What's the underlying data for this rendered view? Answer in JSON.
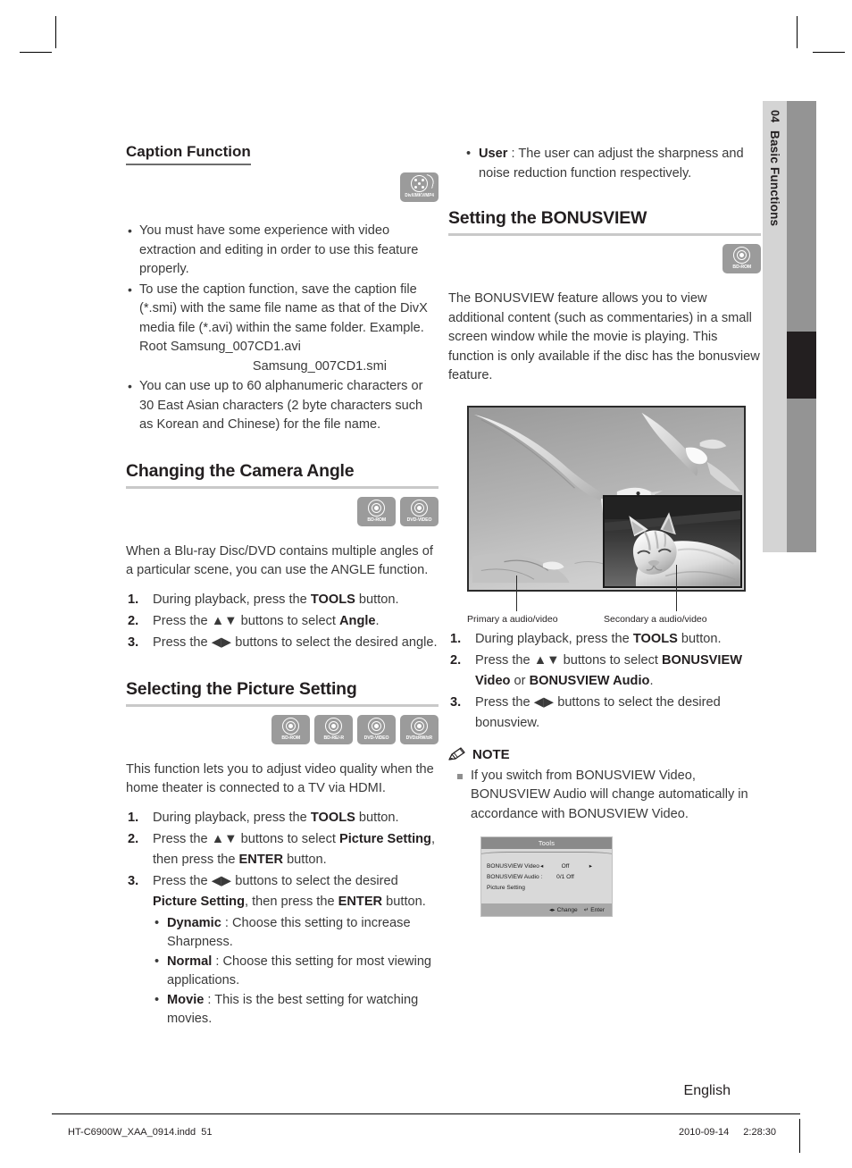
{
  "sidebar_tab": {
    "chapter_number": "04",
    "chapter_title": "Basic Functions"
  },
  "left_column": {
    "caption_function": {
      "title": "Caption Function",
      "badge": {
        "icon": "divx-disc-icon",
        "label": "DivX/MKV/MP4"
      },
      "bullets": [
        "You must have some experience with video extraction and editing in order to use this feature properly.",
        "To use the caption function, save the caption file (*.smi) with the same file name as that of the DivX media file (*.avi) within the same folder. Example. Root Samsung_007CD1.avi",
        "You can use up to 60 alphanumeric characters or 30 East Asian characters (2 byte characters such as Korean and Chinese) for the file name."
      ],
      "example_second_line": "Samsung_007CD1.smi"
    },
    "camera_angle": {
      "title": "Changing the Camera Angle",
      "badges": [
        {
          "icon": "disc-icon",
          "label": "BD-ROM"
        },
        {
          "icon": "disc-icon",
          "label": "DVD-VIDEO"
        }
      ],
      "intro": "When a Blu-ray Disc/DVD contains multiple angles of a particular scene, you can use the ANGLE function.",
      "steps": [
        {
          "num": "1.",
          "text_parts": [
            "During playback, press the ",
            "TOOLS",
            " button."
          ]
        },
        {
          "num": "2.",
          "text_parts": [
            "Press the ▲▼ buttons to select ",
            "Angle",
            "."
          ]
        },
        {
          "num": "3.",
          "text_parts": [
            "Press the ◀▶ buttons to select the desired angle.",
            "",
            ""
          ]
        }
      ]
    },
    "picture_setting": {
      "title": "Selecting the Picture Setting",
      "badges": [
        {
          "icon": "disc-icon",
          "label": "BD-ROM"
        },
        {
          "icon": "disc-icon",
          "label": "BD-RE/-R"
        },
        {
          "icon": "disc-icon",
          "label": "DVD-VIDEO"
        },
        {
          "icon": "disc-icon",
          "label": "DVD±RW/±R"
        }
      ],
      "intro": "This function lets you to adjust video quality when the home theater is connected to a TV via HDMI.",
      "step1": {
        "num": "1.",
        "a": "During playback, press the ",
        "b": "TOOLS",
        "c": " button."
      },
      "step2": {
        "num": "2.",
        "a": "Press the ▲▼ buttons to select ",
        "b": "Picture Setting",
        "c": ", then press the ",
        "d": "ENTER",
        "e": " button."
      },
      "step3": {
        "num": "3.",
        "a": "Press the ◀▶ buttons to select the desired ",
        "b": "Picture Setting",
        "c": ", then press the ",
        "d": "ENTER",
        "e": " button."
      },
      "options": [
        {
          "name": "Dynamic",
          "desc": " : Choose this setting to increase Sharpness."
        },
        {
          "name": "Normal",
          "desc": " : Choose this setting for most viewing applications."
        },
        {
          "name": "Movie",
          "desc": " : This is the best setting for watching movies."
        }
      ]
    }
  },
  "right_column": {
    "user_option": {
      "name": "User",
      "desc": " : The user can adjust the sharpness and noise reduction function respectively."
    },
    "bonusview": {
      "title": "Setting the BONUSVIEW",
      "badge": {
        "icon": "disc-icon",
        "label": "BD-ROM"
      },
      "intro": "The BONUSVIEW feature allows you to view additional content (such as commentaries) in a small screen window while the movie is playing. This function is only available if the disc has the bonusview feature.",
      "figure": {
        "primary_label": "Primary a audio/video",
        "secondary_label": "Secondary a audio/video",
        "primary_alt": "seagulls-flying-photo",
        "secondary_alt": "sleeping-cat-photo"
      },
      "step1": {
        "num": "1.",
        "a": "During playback, press the ",
        "b": "TOOLS",
        "c": " button."
      },
      "step2": {
        "num": "2.",
        "a": "Press the ▲▼ buttons to select ",
        "b": "BONUSVIEW Video",
        "c": " or ",
        "d": "BONUSVIEW Audio",
        "e": "."
      },
      "step3": {
        "num": "3.",
        "a": "Press the ◀▶ buttons to select the desired bonusview."
      },
      "note": {
        "heading": "NOTE",
        "items": [
          "If you switch from BONUSVIEW Video, BONUSVIEW Audio will change automatically in accordance with BONUSVIEW Video."
        ]
      },
      "osd": {
        "title": "Tools",
        "rows": [
          {
            "label": "BONUSVIEW Video",
            "left_arrow": "◂",
            "value": "Off",
            "right_arrow": "▸"
          },
          {
            "label": "BONUSVIEW Audio :",
            "left_arrow": "",
            "value": "0/1 Off",
            "right_arrow": ""
          },
          {
            "label": "Picture Setting",
            "left_arrow": "",
            "value": "",
            "right_arrow": ""
          }
        ],
        "footer": {
          "change_icon": "◂▸",
          "change_label": "Change",
          "enter_icon": "↵",
          "enter_label": "Enter"
        }
      }
    }
  },
  "footer": {
    "language": "English",
    "file_name": "HT-C6900W_XAA_0914.indd",
    "page_number": "51",
    "date": "2010-09-14",
    "time": "2:28:30"
  },
  "colors": {
    "badge_gray": "#9b9b9b",
    "rule_gray": "#c9c9c9",
    "tab_light": "#d4d4d4",
    "tab_dark": "#949494",
    "tab_marker": "#231f20",
    "text": "#231f20"
  }
}
